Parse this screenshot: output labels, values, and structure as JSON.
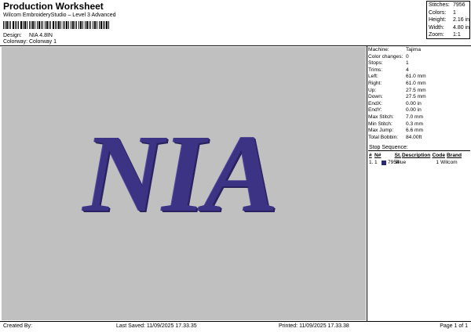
{
  "header": {
    "title": "Production Worksheet",
    "subtitle": "Wilcom EmbroideryStudio – Level 3 Advanced",
    "design_label": "Design:",
    "design_value": "NIA 4.8IN",
    "colorway_label": "Colorway:",
    "colorway_value": "Colorway 1"
  },
  "summary": {
    "stitches_label": "Stitches:",
    "stitches_value": "7956",
    "colors_label": "Colors:",
    "colors_value": "1",
    "height_label": "Height:",
    "height_value": "2.16 in",
    "width_label": "Width:",
    "width_value": "4.80 in",
    "zoom_label": "Zoom:",
    "zoom_value": "1:1"
  },
  "canvas": {
    "design_text": "NIA",
    "background_color": "#c0c0c0",
    "thread_color": "#3d3384"
  },
  "parameters": [
    {
      "label": "Machine:",
      "value": "Tajima"
    },
    {
      "label": "Color changes:",
      "value": "0"
    },
    {
      "label": "Stops:",
      "value": "1"
    },
    {
      "label": "Trims:",
      "value": "4"
    },
    {
      "label": "Left:",
      "value": "61.0 mm"
    },
    {
      "label": "Right:",
      "value": "61.0 mm"
    },
    {
      "label": "Up:",
      "value": "27.5 mm"
    },
    {
      "label": "Down:",
      "value": "27.5 mm"
    },
    {
      "label": "EndX:",
      "value": "0.00 in"
    },
    {
      "label": "EndY:",
      "value": "0.00 in"
    },
    {
      "label": "Max Stitch:",
      "value": "7.0 mm"
    },
    {
      "label": "Min Stitch:",
      "value": "0.3 mm"
    },
    {
      "label": "Max Jump:",
      "value": "6.6 mm"
    },
    {
      "label": "Total Bobbin:",
      "value": "84.00ft"
    }
  ],
  "stop_sequence": {
    "title": "Stop Sequence:",
    "columns": [
      "#",
      "N#",
      "St.",
      "Description",
      "Code",
      "Brand"
    ],
    "rows": [
      {
        "num": "1.",
        "n": "1",
        "swatch": "#2a2a6e",
        "stitches": "7954",
        "description": "Blue",
        "code": "1",
        "brand": "Wilcom"
      }
    ]
  },
  "footer": {
    "created_by": "Created By:",
    "last_saved": "Last Saved: 11/09/2025 17.33.35",
    "printed": "Printed: 11/09/2025 17.33.38",
    "page": "Page 1 of 1"
  }
}
